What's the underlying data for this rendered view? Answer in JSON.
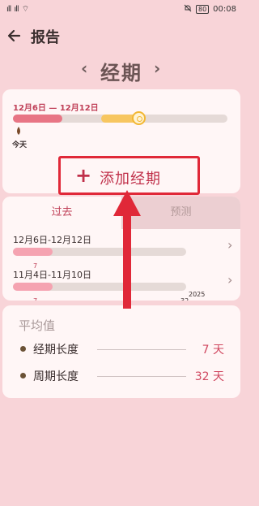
{
  "status_bar": {
    "carrier_left": "ıll",
    "carrier_right": "ıll",
    "wifi": "⌔",
    "mute": "🔕",
    "battery": "80",
    "time": "00:08"
  },
  "header": {
    "title": "报告"
  },
  "switcher": {
    "title": "经期",
    "prev": "‹",
    "next": "›"
  },
  "current_period": {
    "range": "12月6日 — 12月12日",
    "today_label": "今天",
    "period_fraction": 0.23,
    "fertile_start_fraction": 0.41,
    "fertile_end_fraction": 0.61,
    "colors": {
      "period": "#e87585",
      "fertile": "#f7c660",
      "track": "#e5dad7"
    }
  },
  "add_button": {
    "plus": "+",
    "label": "添加经期"
  },
  "history": {
    "tabs": [
      {
        "label": "过去",
        "active": true
      },
      {
        "label": "预测",
        "active": false
      }
    ],
    "rows": [
      {
        "date": "12月6日-12月12日",
        "days": "7",
        "cycle": "",
        "fill_fraction": 0.23
      },
      {
        "date": "11月4日-11月10日",
        "days": "7",
        "cycle": "32",
        "fill_fraction": 0.23
      }
    ],
    "year": "2025"
  },
  "averages": {
    "title": "平均值",
    "items": [
      {
        "label": "经期长度",
        "value": "7 天"
      },
      {
        "label": "周期长度",
        "value": "32 天"
      }
    ]
  },
  "colors": {
    "background": "#f8d4d8",
    "accent": "#c04058",
    "annotation": "#e02838"
  }
}
